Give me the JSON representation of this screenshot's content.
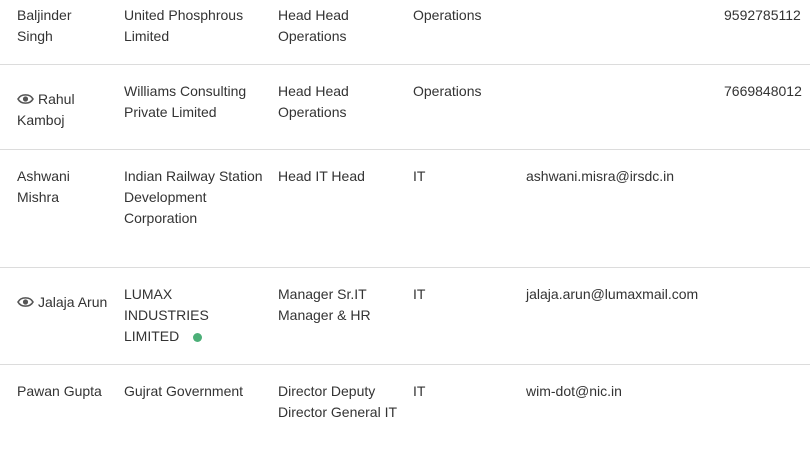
{
  "colors": {
    "text": "#333333",
    "divider": "#dcdcdc",
    "status_active": "#4caf78",
    "eye_icon": "#555555"
  },
  "rows": [
    {
      "name": "Baljinder Singh",
      "has_view_icon": false,
      "company": "United Phosphrous Limited",
      "title": "Head Head Operations",
      "department": "Operations",
      "email": "",
      "phone": "9592785112"
    },
    {
      "name": "Rahul Kamboj",
      "has_view_icon": true,
      "company": "Williams Consulting Private Limited",
      "title": "Head Head Operations",
      "department": "Operations",
      "email": "",
      "phone": "7669848012"
    },
    {
      "name": "Ashwani Mishra",
      "has_view_icon": false,
      "company": "Indian Railway Station Development Corporation",
      "title": "Head IT Head",
      "department": "IT",
      "email": "ashwani.misra@irsdc.in",
      "phone": ""
    },
    {
      "name": "Jalaja Arun",
      "has_view_icon": true,
      "company": "LUMAX INDUSTRIES LIMITED",
      "company_status_dot": true,
      "title": "Manager Sr.IT Manager & HR",
      "department": "IT",
      "email": "jalaja.arun@lumaxmail.com",
      "phone": ""
    },
    {
      "name": "Pawan Gupta",
      "has_view_icon": false,
      "company": "Gujrat Government",
      "title": "Director Deputy Director General IT",
      "department": "IT",
      "email": "wim-dot@nic.in",
      "phone": ""
    }
  ]
}
